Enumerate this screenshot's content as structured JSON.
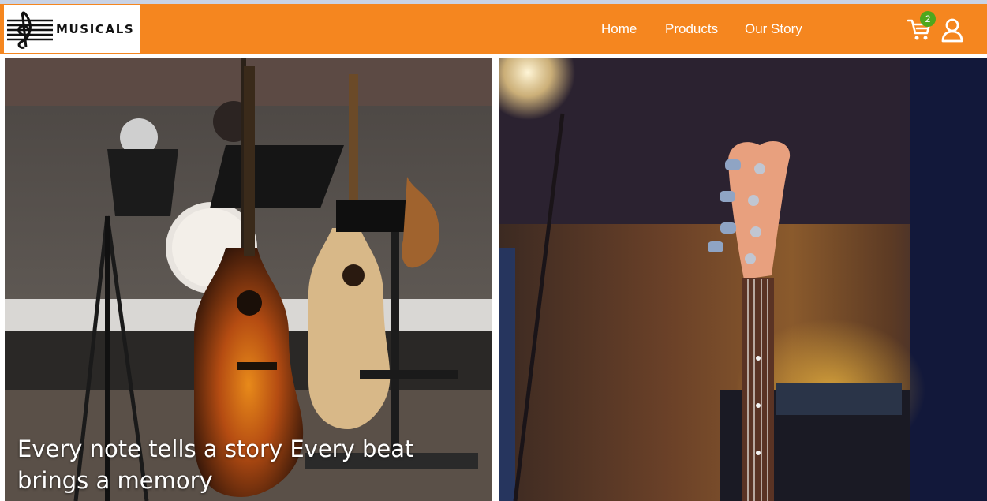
{
  "brand": {
    "name": "MUSICALS",
    "logo_icon": "treble-clef-icon"
  },
  "nav": {
    "items": [
      {
        "label": "Home"
      },
      {
        "label": "Products"
      },
      {
        "label": "Our Story"
      }
    ]
  },
  "cart": {
    "count": "2",
    "icon": "cart-icon"
  },
  "account": {
    "icon": "user-icon"
  },
  "hero": {
    "left_caption": "Every note tells a story Every beat brings a memory",
    "left_image": "acoustic guitars and drum kit on stage",
    "right_image": "bass guitar headstock in dim room"
  },
  "colors": {
    "header": "#f5861f",
    "badge": "#4ea71d",
    "text": "#ffffff"
  }
}
